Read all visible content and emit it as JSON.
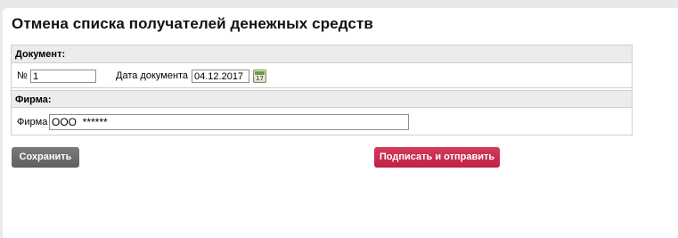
{
  "page": {
    "title": "Отмена списка получателей денежных средств"
  },
  "document_section": {
    "header": "Документ:",
    "number_label": "№",
    "number_value": "1",
    "date_label": "Дата документа",
    "date_value": "04.12.2017",
    "calendar_icon": "calendar-icon",
    "calendar_day": "17"
  },
  "firm_section": {
    "header": "Фирма:",
    "firm_label": "Фирма",
    "firm_value": "ООО  ******"
  },
  "actions": {
    "save_label": "Сохранить",
    "sign_send_label": "Подписать и отправить"
  },
  "colors": {
    "save_button": "#6e6e6e",
    "sign_button": "#c8284d",
    "section_header_bg": "#ececec",
    "border": "#cfcfcf"
  }
}
